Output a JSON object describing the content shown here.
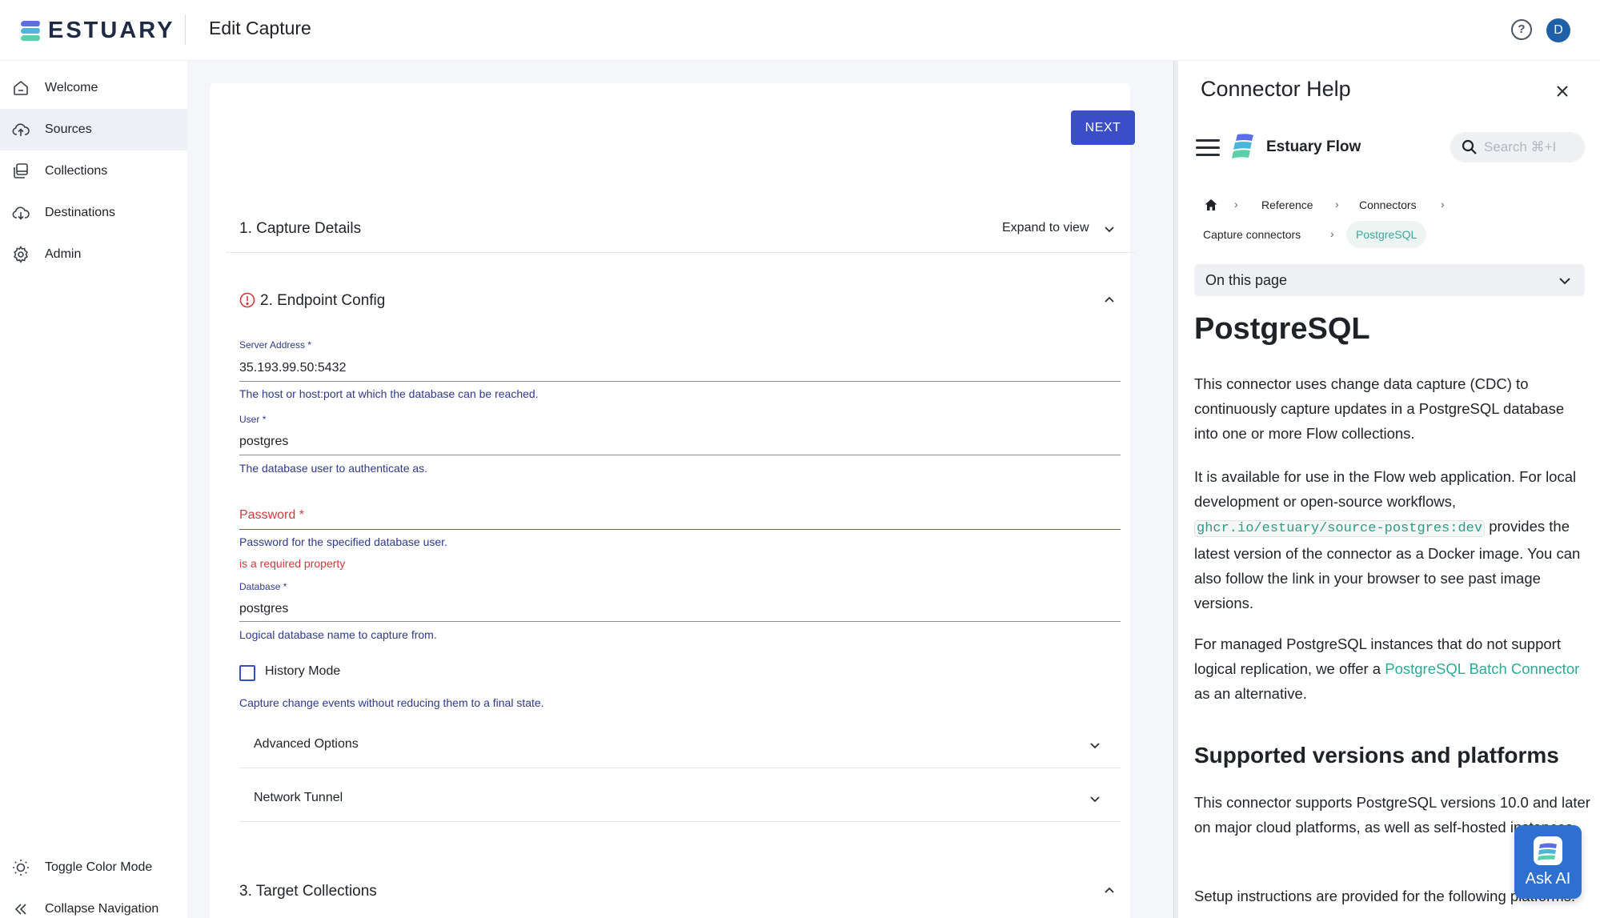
{
  "header": {
    "logo_text": "ESTUARY",
    "page_title": "Edit Capture",
    "avatar_initial": "D",
    "help_glyph": "?"
  },
  "nav": {
    "items": [
      {
        "label": "Welcome",
        "icon": "home-icon"
      },
      {
        "label": "Sources",
        "icon": "cloud-upload-icon",
        "active": true
      },
      {
        "label": "Collections",
        "icon": "collections-icon"
      },
      {
        "label": "Destinations",
        "icon": "cloud-download-icon"
      },
      {
        "label": "Admin",
        "icon": "gear-icon"
      }
    ],
    "bottom": [
      {
        "label": "Toggle Color Mode",
        "icon": "sun-icon"
      },
      {
        "label": "Collapse Navigation",
        "icon": "double-chevron-left-icon"
      }
    ]
  },
  "form": {
    "next_label": "NEXT",
    "sections": {
      "capture_details": "1. Capture Details",
      "expand_label": "Expand to view",
      "endpoint_config": "2. Endpoint Config",
      "target_collections": "3. Target Collections"
    },
    "fields": {
      "server_address": {
        "label": "Server Address",
        "required": "*",
        "value": "35.193.99.50:5432",
        "help": "The host or host:port at which the database can be reached."
      },
      "user": {
        "label": "User",
        "required": "*",
        "value": "postgres",
        "help": "The database user to authenticate as."
      },
      "password": {
        "label": "Password",
        "required": "*",
        "value": "",
        "help": "Password for the specified database user.",
        "error": "is a required property"
      },
      "database": {
        "label": "Database",
        "required": "*",
        "value": "postgres",
        "help": "Logical database name to capture from."
      },
      "history_mode": {
        "label": "History Mode",
        "checked": false,
        "help": "Capture change events without reducing them to a final state."
      }
    },
    "collapsibles": {
      "advanced_options": "Advanced Options",
      "network_tunnel": "Network Tunnel"
    }
  },
  "help_panel": {
    "title": "Connector Help",
    "site_title": "Estuary Flow",
    "search_placeholder": "Search ⌘+I",
    "breadcrumbs": [
      "Reference",
      "Connectors",
      "Capture connectors"
    ],
    "breadcrumb_active": "PostgreSQL",
    "on_this_page": "On this page",
    "doc_title": "PostgreSQL",
    "p1": "This connector uses change data capture (CDC) to continuously capture updates in a PostgreSQL database into one or more Flow collections.",
    "p2_a": "It is available for use in the Flow web application. For local development or open-source workflows,",
    "p2_code": "ghcr.io/estuary/source-postgres:dev",
    "p2_b": "provides the latest version of the connector as a Docker image. You can also follow the link in your browser to see past image versions.",
    "p3_a": "For managed PostgreSQL instances that do not support logical replication, we offer a",
    "p3_link": "PostgreSQL Batch Connector",
    "p3_b": "as an alternative.",
    "h2": "Supported versions and platforms",
    "p4": "This connector supports PostgreSQL versions 10.0 and later on major cloud platforms, as well as self-hosted instances.",
    "p5": "Setup instructions are provided for the following platforms:",
    "ask_ai": "Ask AI"
  },
  "colors": {
    "primary": "#3a4fc7",
    "error": "#d23a3a",
    "link": "#2eaa96",
    "help_text": "#2e3a8c"
  }
}
